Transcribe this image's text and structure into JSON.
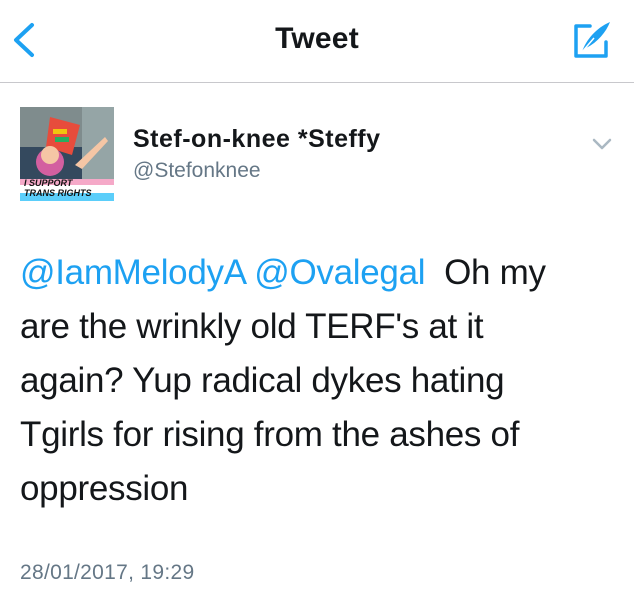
{
  "nav": {
    "title": "Tweet",
    "back_icon": "chevron-left-icon",
    "compose_icon": "compose-quill-icon"
  },
  "colors": {
    "accent": "#1da1f2",
    "secondary_text": "#657786",
    "primary_text": "#14171a"
  },
  "author": {
    "display_name": "Stef-on-knee *Steffy",
    "handle": "@Stefonknee",
    "avatar": {
      "banner_text": "I SUPPORT TRANS RIGHTS"
    }
  },
  "tweet": {
    "mention_1": "@IamMelodyA",
    "mention_2": "@Ovalegal",
    "text_line_1": "Oh my",
    "text_line_2": "are the wrinkly old TERF's at it",
    "text_line_3": "again? Yup radical dykes hating",
    "text_line_4": "Tgirls for rising from the ashes of",
    "text_line_5": "oppression",
    "timestamp": "28/01/2017, 19:29"
  }
}
